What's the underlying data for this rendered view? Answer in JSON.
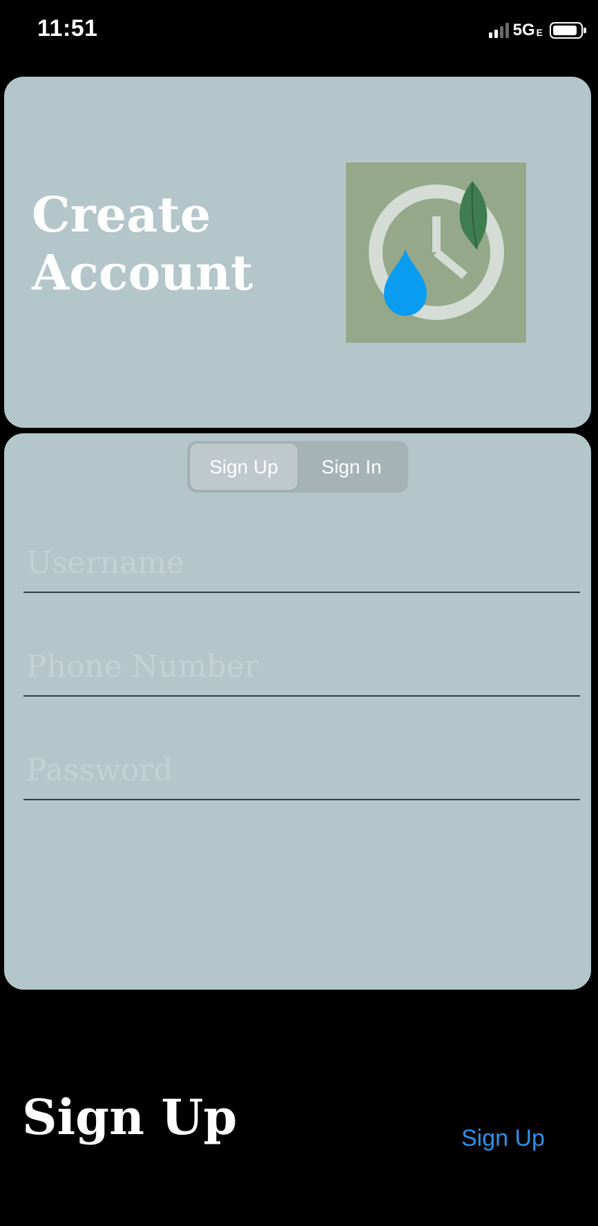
{
  "status_bar": {
    "time": "11:51",
    "network": "5G",
    "network_sub": "E",
    "signal_icon": "signal-bars-icon",
    "battery_icon": "battery-icon"
  },
  "header": {
    "title": "Create\nAccount",
    "logo_icon": "clock-droplet-leaf-logo",
    "colors": {
      "card_bg": "#b4c6ca",
      "logo_bg": "#95a88a",
      "droplet": "#0a9cf0",
      "leaf": "#3f7d4f"
    }
  },
  "form": {
    "tabs": [
      {
        "label": "Sign Up",
        "selected": true
      },
      {
        "label": "Sign In",
        "selected": false
      }
    ],
    "fields": {
      "username": {
        "placeholder": "Username",
        "value": ""
      },
      "phone": {
        "placeholder": "Phone Number",
        "value": ""
      },
      "password": {
        "placeholder": "Password",
        "value": ""
      }
    }
  },
  "footer": {
    "title": "Sign Up",
    "action_label": "Sign Up",
    "action_color": "#2f8fe8"
  }
}
